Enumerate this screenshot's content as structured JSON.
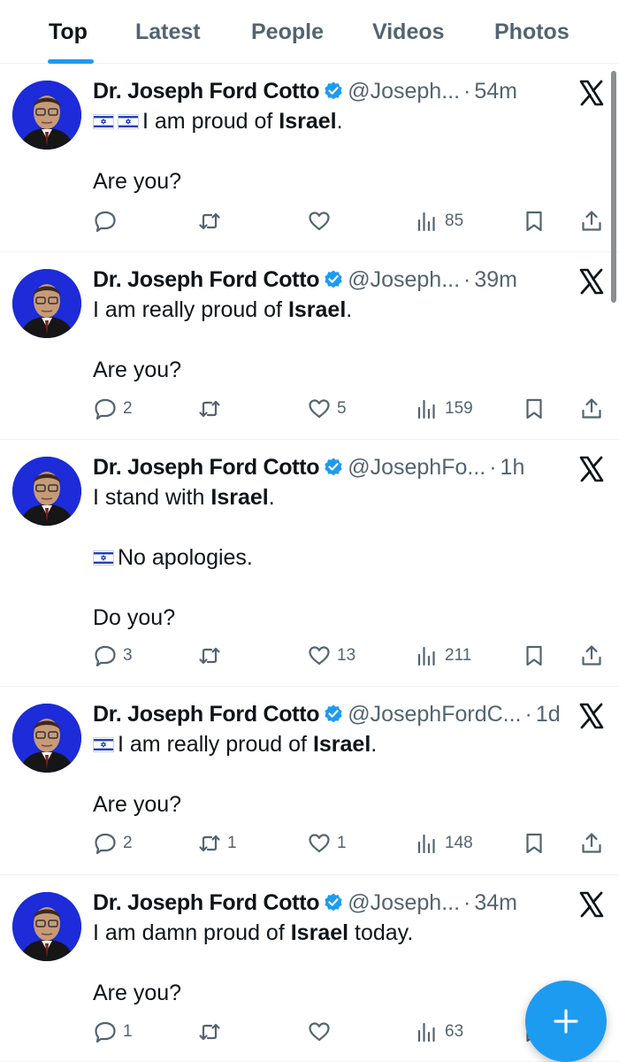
{
  "tabs": [
    {
      "label": "Top",
      "active": true
    },
    {
      "label": "Latest",
      "active": false
    },
    {
      "label": "People",
      "active": false
    },
    {
      "label": "Videos",
      "active": false
    },
    {
      "label": "Photos",
      "active": false
    }
  ],
  "colors": {
    "accent": "#1d9bf0",
    "text": "#0f1419",
    "muted": "#536471",
    "avatar_bg": "#1d2bd8"
  },
  "icons": {
    "verified": "verified-badge-icon",
    "platform": "x-logo-icon",
    "flag": "israel-flag-icon",
    "compose": "plus-icon"
  },
  "tweets": [
    {
      "name": "Dr. Joseph Ford Cotto",
      "handle": "@Joseph...",
      "dot": "·",
      "time": "54m",
      "lines": [
        {
          "flags": 2,
          "pre": "I am proud of ",
          "bold": "Israel",
          "post": "."
        },
        {
          "flags": 0,
          "pre": "",
          "bold": "",
          "post": ""
        },
        {
          "flags": 0,
          "pre": "Are you?",
          "bold": "",
          "post": ""
        }
      ],
      "replies": "",
      "retweets": "",
      "likes": "",
      "views": "85"
    },
    {
      "name": "Dr. Joseph Ford Cotto",
      "handle": "@Joseph...",
      "dot": "·",
      "time": "39m",
      "lines": [
        {
          "flags": 0,
          "pre": "I am really proud of ",
          "bold": "Israel",
          "post": "."
        },
        {
          "flags": 0,
          "pre": "",
          "bold": "",
          "post": ""
        },
        {
          "flags": 0,
          "pre": "Are you?",
          "bold": "",
          "post": ""
        }
      ],
      "replies": "2",
      "retweets": "",
      "likes": "5",
      "views": "159"
    },
    {
      "name": "Dr. Joseph Ford Cotto",
      "handle": "@JosephFo...",
      "dot": "·",
      "time": "1h",
      "lines": [
        {
          "flags": 0,
          "pre": "I stand with ",
          "bold": "Israel",
          "post": "."
        },
        {
          "flags": 0,
          "pre": "",
          "bold": "",
          "post": ""
        },
        {
          "flags": 1,
          "pre": "No apologies.",
          "bold": "",
          "post": ""
        },
        {
          "flags": 0,
          "pre": "",
          "bold": "",
          "post": ""
        },
        {
          "flags": 0,
          "pre": "Do you?",
          "bold": "",
          "post": ""
        }
      ],
      "replies": "3",
      "retweets": "",
      "likes": "13",
      "views": "211"
    },
    {
      "name": "Dr. Joseph Ford Cotto",
      "handle": "@JosephFordC...",
      "dot": "·",
      "time": "1d",
      "lines": [
        {
          "flags": 1,
          "pre": "I am really proud of ",
          "bold": "Israel",
          "post": "."
        },
        {
          "flags": 0,
          "pre": "",
          "bold": "",
          "post": ""
        },
        {
          "flags": 0,
          "pre": "Are you?",
          "bold": "",
          "post": ""
        }
      ],
      "replies": "2",
      "retweets": "1",
      "likes": "1",
      "views": "148"
    },
    {
      "name": "Dr. Joseph Ford Cotto",
      "handle": "@Joseph...",
      "dot": "·",
      "time": "34m",
      "lines": [
        {
          "flags": 0,
          "pre": "I am damn proud of ",
          "bold": "Israel",
          "post": " today."
        },
        {
          "flags": 0,
          "pre": "",
          "bold": "",
          "post": ""
        },
        {
          "flags": 0,
          "pre": "Are you?",
          "bold": "",
          "post": ""
        }
      ],
      "replies": "1",
      "retweets": "",
      "likes": "",
      "views": "63"
    }
  ]
}
